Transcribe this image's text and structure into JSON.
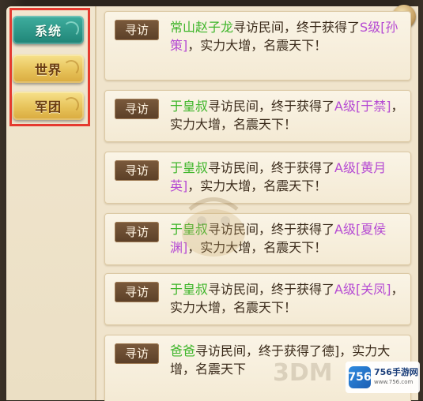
{
  "tabs": [
    {
      "label": "系统",
      "active": true
    },
    {
      "label": "世界",
      "active": false
    },
    {
      "label": "军团",
      "active": false
    }
  ],
  "messages": [
    {
      "badge": "寻访",
      "name": "常山赵子龙",
      "pre": "寻访民间，终于获得了",
      "grade": "S级[孙策]",
      "post": "，实力大增，名震天下！"
    },
    {
      "badge": "寻访",
      "name": "于皇叔",
      "pre": "寻访民间，终于获得了",
      "grade": "A级[于禁]",
      "post": "，实力大增，名震天下！"
    },
    {
      "badge": "寻访",
      "name": "于皇叔",
      "pre": "寻访民间，终于获得了",
      "grade": "A级[黄月英]",
      "post": "，实力大增，名震天下！"
    },
    {
      "badge": "寻访",
      "name": "于皇叔",
      "pre": "寻访民间，终于获得了",
      "grade": "A级[夏侯渊]",
      "post": "，实力大增，名震天下！"
    },
    {
      "badge": "寻访",
      "name": "于皇叔",
      "pre": "寻访民间，终于获得了",
      "grade": "A级[关凤]",
      "post": "，实力大增，名震天下！"
    },
    {
      "badge": "寻访",
      "name": "爸爸",
      "pre": "寻访民间，终于获得了",
      "grade": "",
      "post": "德]，实力大增，名震天下"
    }
  ],
  "logo": {
    "mark": "756",
    "brand": "756手游网",
    "url": "www.756.com"
  },
  "watermark_text": "3DM",
  "colors": {
    "name": "#3eb52a",
    "grade": "#b54ad3",
    "tab_active": "#1f8476",
    "tab_inactive": "#e7c35a",
    "highlight": "#e53a2f"
  }
}
